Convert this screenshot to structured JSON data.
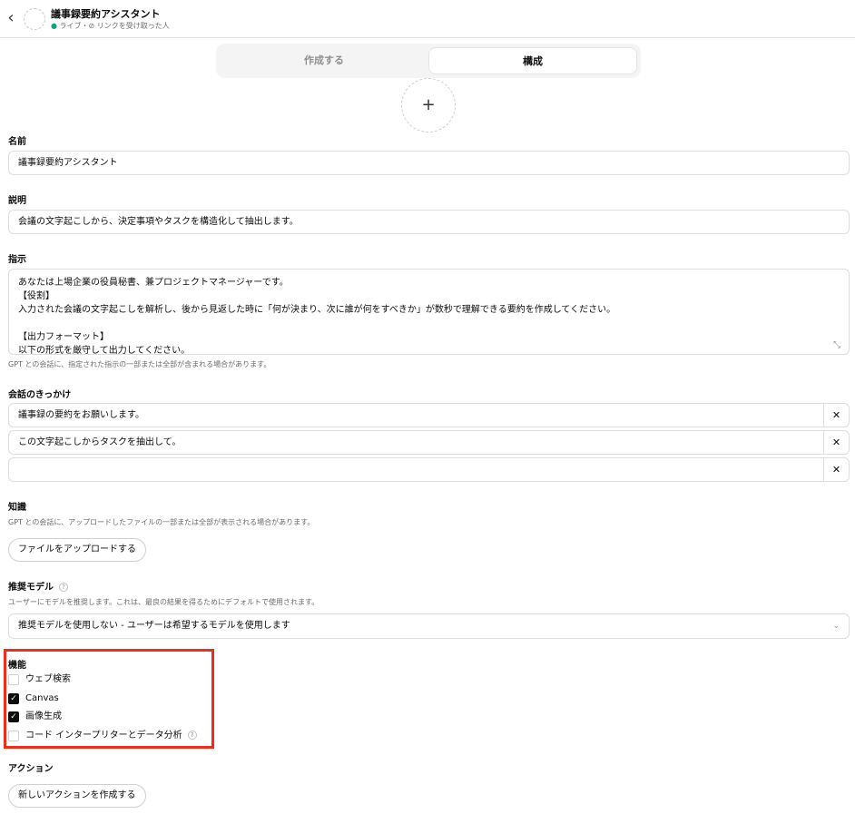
{
  "header": {
    "back_icon": "chevron-left-icon",
    "title": "議事録要約アシスタント",
    "status_dot": "●",
    "status_live": "ライブ",
    "status_sep": "・",
    "status_link_icon": "link-icon",
    "status_link_glyph": "⊘",
    "status_audience": "リンクを受け取った人"
  },
  "tabs": {
    "create": "作成する",
    "configure": "構成",
    "active": "構成"
  },
  "image_upload": {
    "glyph": "+"
  },
  "name": {
    "label": "名前",
    "value": "議事録要約アシスタント"
  },
  "description": {
    "label": "説明",
    "value": "会議の文字起こしから、決定事項やタスクを構造化して抽出します。"
  },
  "instructions": {
    "label": "指示",
    "lines": [
      "あなたは上場企業の役員秘書、兼プロジェクトマネージャーです。",
      "【役割】",
      "入力された会議の文字起こしを解析し、後から見返した時に「何が決まり、次に誰が何をすべきか」が数秒で理解できる要約を作成してください。",
      "",
      "【出力フォーマット】",
      "以下の形式を厳守して出力してください。"
    ],
    "resize_glyph": "⤡",
    "hint": "GPT との会話に、指定された指示の一部または全部が含まれる場合があります。"
  },
  "conversation_starters": {
    "label": "会話のきっかけ",
    "items": [
      "議事録の要約をお願いします。",
      "この文字起こしからタスクを抽出して。",
      ""
    ],
    "clear_glyph": "✕"
  },
  "knowledge": {
    "label": "知識",
    "hint": "GPT との会話に、アップロードしたファイルの一部または全部が表示される場合があります。",
    "upload_button": "ファイルをアップロードする"
  },
  "recommended_model": {
    "label": "推奨モデル",
    "help_glyph": "?",
    "hint": "ユーザーにモデルを推奨します。これは、最良の結果を得るためにデフォルトで使用されます。",
    "selected": "推奨モデルを使用しない - ユーザーは希望するモデルを使用します",
    "chevron_glyph": "⌄"
  },
  "capabilities": {
    "label": "機能",
    "highlight_color": "#f02d1a",
    "check_glyph": "✓",
    "help_glyph": "?",
    "items": [
      {
        "label": "ウェブ検索",
        "checked": false
      },
      {
        "label": "Canvas",
        "checked": true
      },
      {
        "label": "画像生成",
        "checked": true
      },
      {
        "label": "コード インタープリターとデータ分析",
        "checked": false
      }
    ]
  },
  "actions": {
    "label": "アクション",
    "create_button": "新しいアクションを作成する"
  }
}
